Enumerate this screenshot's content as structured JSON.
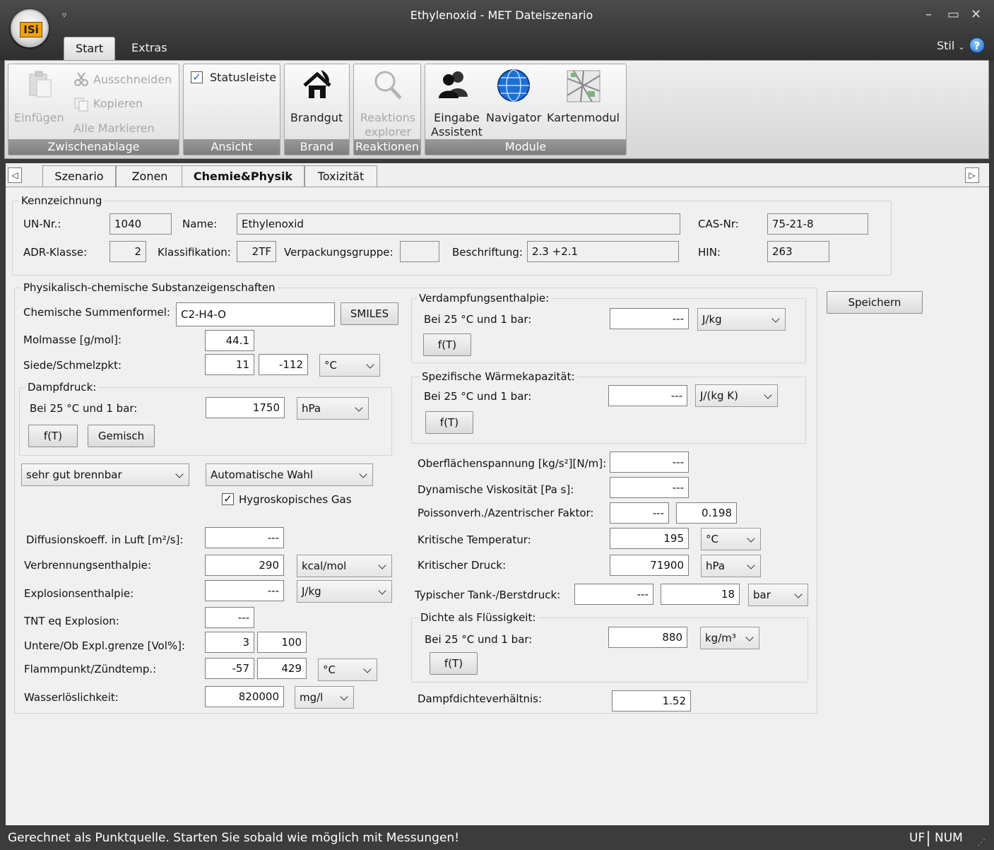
{
  "window": {
    "title": "Ethylenoxid - MET Dateiszenario",
    "logo": "ISi",
    "quick_access": "▿",
    "min": "–",
    "max": "▭",
    "close": "✕"
  },
  "ribbon_tabs": {
    "start": "Start",
    "extras": "Extras",
    "stil": "Stil",
    "help": "?"
  },
  "ribbon": {
    "clipboard": {
      "paste": "Einfügen",
      "cut": "Ausschneiden",
      "copy": "Kopieren",
      "select_all": "Alle Markieren",
      "caption": "Zwischenablage"
    },
    "view": {
      "statusbar": "Statusleiste",
      "statusbar_check": "✓",
      "caption": "Ansicht"
    },
    "fire": {
      "brandgut": "Brandgut",
      "caption": "Brand"
    },
    "reactions": {
      "explorer_line1": "Reaktions",
      "explorer_line2": "explorer",
      "caption": "Reaktionen"
    },
    "modules": {
      "wizard_line1": "Eingabe",
      "wizard_line2": "Assistent",
      "navigator": "Navigator",
      "map": "Kartenmodul",
      "caption": "Module"
    }
  },
  "doc_tabs": {
    "scroll_left": "◁",
    "scroll_right": "▷",
    "tabs": [
      "Szenario",
      "Zonen",
      "Chemie&Physik",
      "Toxizität"
    ]
  },
  "kennzeichnung": {
    "title": "Kennzeichnung",
    "un_label": "UN-Nr.:",
    "un": "1040",
    "name_label": "Name:",
    "name": "Ethylenoxid",
    "cas_label": "CAS-Nr:",
    "cas": "75-21-8",
    "adr_label": "ADR-Klasse:",
    "adr": "2",
    "klass_label": "Klassifikation:",
    "klass": "2TF",
    "vpg_label": "Verpackungsgruppe:",
    "vpg": "",
    "beschr_label": "Beschriftung:",
    "beschr": "2.3 +2.1",
    "hin_label": "HIN:",
    "hin": "263"
  },
  "physchem": {
    "title": "Physikalisch-chemische Substanzeigenschaften",
    "formula_label": "Chemische Summenformel:",
    "formula": "C2-H4-O",
    "smiles": "SMILES",
    "molmass_label": "Molmasse [g/mol]:",
    "molmass": "44.1",
    "boil_label": "Siede/Schmelzpkt:",
    "boil": "11",
    "melt": "-112",
    "boil_unit": "°C",
    "vapor": {
      "title": "Dampfdruck:",
      "cond": "Bei 25 °C und 1 bar:",
      "value": "1750",
      "unit": "hPa",
      "ft": "f(T)",
      "mix": "Gemisch"
    },
    "flammability": "sehr gut brennbar",
    "auto": "Automatische Wahl",
    "hygro": "Hygroskopisches Gas",
    "hygro_check": "✓",
    "diff_label": "Diffusionskoeff. in Luft [m²/s]:",
    "diff": "---",
    "comb_label": "Verbrennungsenthalpie:",
    "comb": "290",
    "comb_unit": "kcal/mol",
    "expl_label": "Explosionsenthalpie:",
    "expl": "---",
    "expl_unit": "J/kg",
    "tnt_label": "TNT eq Explosion:",
    "tnt": "---",
    "lel_label": "Untere/Ob Expl.grenze [Vol%]:",
    "lel": "3",
    "uel": "100",
    "flash_label": "Flammpunkt/Zündtemp.:",
    "flash": "-57",
    "ignition": "429",
    "flash_unit": "°C",
    "water_label": "Wasserlöslichkeit:",
    "water": "820000",
    "water_unit": "mg/l"
  },
  "right": {
    "evap": {
      "title": "Verdampfungsenthalpie:",
      "cond": "Bei 25 °C und 1 bar:",
      "value": "---",
      "unit": "J/kg",
      "ft": "f(T)"
    },
    "heatcap": {
      "title": "Spezifische Wärmekapazität:",
      "cond": "Bei 25 °C und 1 bar:",
      "value": "---",
      "unit": "J/(kg K)",
      "ft": "f(T)"
    },
    "surface_label": "Oberflächenspannung [kg/s²][N/m]:",
    "surface": "---",
    "visc_label": "Dynamische Viskosität [Pa s]:",
    "visc": "---",
    "poisson_label": "Poissonverh./Azentrischer Faktor:",
    "poisson": "---",
    "acentric": "0.198",
    "tcrit_label": "Kritische Temperatur:",
    "tcrit": "195",
    "tcrit_unit": "°C",
    "pcrit_label": "Kritischer Druck:",
    "pcrit": "71900",
    "pcrit_unit": "hPa",
    "tank_label": "Typischer Tank-/Berstdruck:",
    "tank": "---",
    "burst": "18",
    "tank_unit": "bar",
    "density": {
      "title": "Dichte als Flüssigkeit:",
      "cond": "Bei 25 °C und 1 bar:",
      "value": "880",
      "unit": "kg/m³",
      "ft": "f(T)"
    },
    "vdr_label": "Dampfdichteverhältnis:",
    "vdr": "1.52"
  },
  "save": "Speichern",
  "status": {
    "message": "Gerechnet als Punktquelle. Starten Sie sobald wie möglich mit Messungen!",
    "uf": "UF",
    "num": "NUM"
  }
}
